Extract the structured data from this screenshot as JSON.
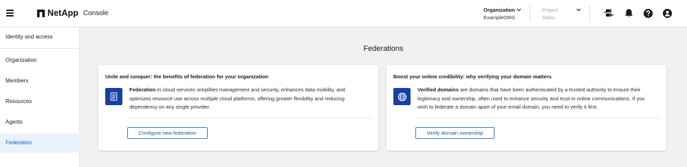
{
  "header": {
    "brand": "NetApp",
    "app_name": "Console",
    "organization": {
      "label": "Organization",
      "value": "ExampleORG"
    },
    "project": {
      "label": "Project",
      "value": "Sales"
    }
  },
  "sidebar": {
    "items": [
      {
        "label": "Identity and access",
        "active": false
      },
      {
        "label": "Organization",
        "active": false
      },
      {
        "label": "Members",
        "active": false
      },
      {
        "label": "Resources",
        "active": false
      },
      {
        "label": "Agents",
        "active": false
      },
      {
        "label": "Federation",
        "active": true
      }
    ]
  },
  "main": {
    "title": "Federations",
    "cards": [
      {
        "title": "Unite and conquer: the benefits of federation for your organization",
        "lead": "Federation",
        "body_line1": "in cloud services simplifies management and security, enhances data mobility, and",
        "body_line2": "optimizes resource use across multiple cloud platforms, offering greater flexibility and reducing",
        "body_line3": "dependency on any single provider.",
        "button": "Configure new federation"
      },
      {
        "title": "Boost your online credibility: why verifying your domain matters",
        "lead": "Verified domains",
        "body_line1": "are domains that have been authenticated by a trusted authority to ensure their",
        "body_line2": "legitimacy and ownership, often used to enhance security and trust in online communications. If you",
        "body_line3": "wish to federate a domain apart of your email domain, you need to verify it first.",
        "button": "Verify domain ownership"
      }
    ]
  },
  "colors": {
    "accent": "#0e64c8",
    "icon_tile": "#1640a8",
    "active_nav_bg": "#e9f2fb",
    "page_bg": "#f1f1f1"
  },
  "icons": {
    "menu": "hamburger-menu",
    "org_dropdown": "chevron-down",
    "project_dropdown": "chevron-down",
    "toolbar": [
      "agent-server-icon",
      "bell-icon",
      "help-icon",
      "user-icon"
    ],
    "federation_card": "document-icon",
    "domain_card": "globe-icon"
  }
}
